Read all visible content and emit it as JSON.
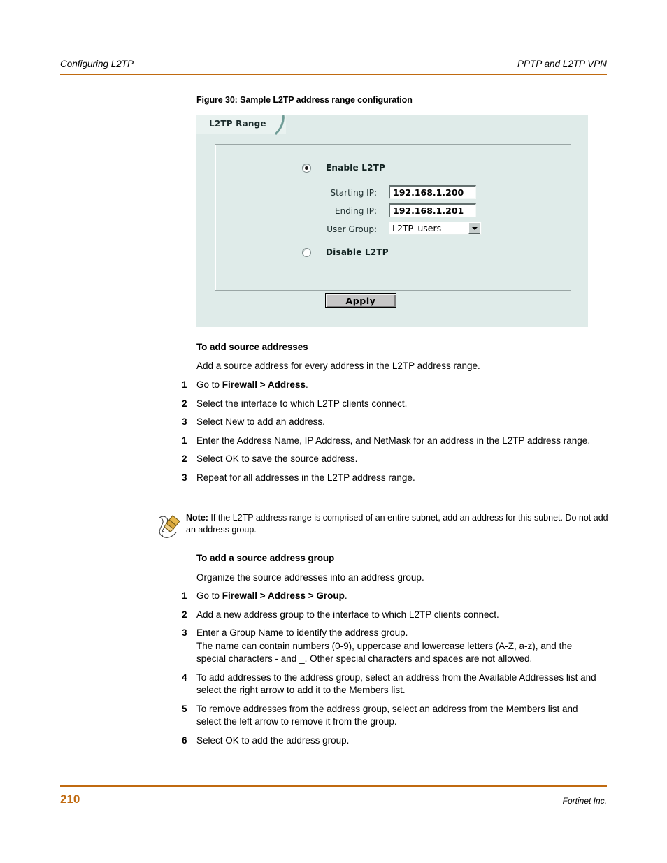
{
  "header": {
    "left": "Configuring L2TP",
    "right": "PPTP and L2TP VPN",
    "rule_color": "#C06A10"
  },
  "figure": {
    "caption": "Figure 30: Sample L2TP address range configuration",
    "panel": {
      "tab_label": "L2TP Range",
      "background": "#dfebe9",
      "enable_option": {
        "label": "Enable L2TP",
        "selected": true
      },
      "disable_option": {
        "label": "Disable L2TP",
        "selected": false
      },
      "fields": {
        "starting_ip_label": "Starting IP:",
        "starting_ip_value": "192.168.1.200",
        "ending_ip_label": "Ending IP:",
        "ending_ip_value": "192.168.1.201",
        "user_group_label": "User Group:",
        "user_group_value": "L2TP_users"
      },
      "apply_button": "Apply"
    }
  },
  "section_one": {
    "heading": "To add source addresses",
    "intro": "Add a source address for every address in the L2TP address range.",
    "steps": [
      {
        "num": "1",
        "html": "Go to <b>Firewall &gt; Address</b>."
      },
      {
        "num": "2",
        "html": "Select the interface to which L2TP clients connect."
      },
      {
        "num": "3",
        "html": "Select New to add an address."
      },
      {
        "num": "1",
        "html": "Enter the Address Name, IP Address, and NetMask for an address in the L2TP address range."
      },
      {
        "num": "2",
        "html": "Select OK to save the source address."
      },
      {
        "num": "3",
        "html": "Repeat for all addresses in the L2TP address range."
      }
    ]
  },
  "note": {
    "icon": "note-pencil-icon",
    "html": "<b>Note:</b> If the L2TP address range is comprised of an entire subnet, add an address for this subnet. Do not add an address group."
  },
  "section_two": {
    "heading": "To add a source address group",
    "intro": "Organize the source addresses into an address group.",
    "steps": [
      {
        "num": "1",
        "html": "Go to <b>Firewall &gt; Address &gt; Group</b>."
      },
      {
        "num": "2",
        "html": "Add a new address group to the interface to which L2TP clients connect."
      },
      {
        "num": "3",
        "html": "Enter a Group Name to identify the address group.<br>The name can contain numbers (0-9), uppercase and lowercase letters (A-Z, a-z), and the special characters - and _. Other special characters and spaces are not allowed."
      },
      {
        "num": "4",
        "html": "To add addresses to the address group, select an address from the Available Addresses list and select the right arrow to add it to the Members list."
      },
      {
        "num": "5",
        "html": "To remove addresses from the address group, select an address from the Members list and select the left arrow to remove it from the group."
      },
      {
        "num": "6",
        "html": "Select OK to add the address group."
      }
    ]
  },
  "footer": {
    "page_number": "210",
    "company": "Fortinet Inc."
  }
}
